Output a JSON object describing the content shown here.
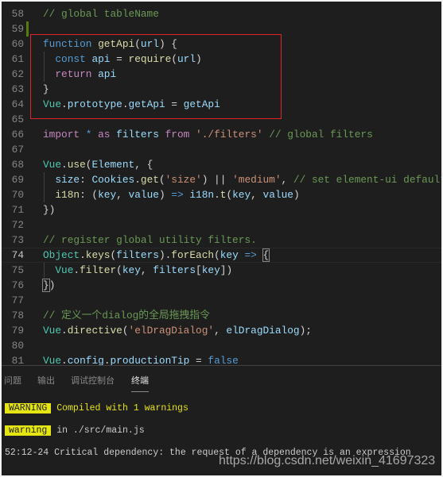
{
  "editor": {
    "current_line": 74,
    "lines": [
      {
        "n": "58",
        "t": [
          [
            "// global tableName",
            "cmt"
          ]
        ]
      },
      {
        "n": "59",
        "t": []
      },
      {
        "n": "60",
        "t": [
          [
            "function",
            "kw"
          ],
          [
            " ",
            "op"
          ],
          [
            "getApi",
            "fn"
          ],
          [
            "(",
            "op"
          ],
          [
            "url",
            "var"
          ],
          [
            ") {",
            "op"
          ]
        ]
      },
      {
        "n": "61",
        "t": [
          [
            "  ",
            "op"
          ],
          [
            "const",
            "kw"
          ],
          [
            " ",
            "op"
          ],
          [
            "api",
            "var"
          ],
          [
            " = ",
            "op"
          ],
          [
            "require",
            "fn"
          ],
          [
            "(",
            "op"
          ],
          [
            "url",
            "var"
          ],
          [
            ")",
            "op"
          ]
        ]
      },
      {
        "n": "62",
        "t": [
          [
            "  ",
            "op"
          ],
          [
            "return",
            "ctl"
          ],
          [
            " ",
            "op"
          ],
          [
            "api",
            "var"
          ]
        ]
      },
      {
        "n": "63",
        "t": [
          [
            "}",
            "op"
          ]
        ]
      },
      {
        "n": "64",
        "t": [
          [
            "Vue",
            "cls"
          ],
          [
            ".",
            "op"
          ],
          [
            "prototype",
            "var"
          ],
          [
            ".",
            "op"
          ],
          [
            "getApi",
            "var"
          ],
          [
            " = ",
            "op"
          ],
          [
            "getApi",
            "var"
          ]
        ]
      },
      {
        "n": "65",
        "t": []
      },
      {
        "n": "66",
        "t": [
          [
            "import",
            "ctl"
          ],
          [
            " * ",
            "kw"
          ],
          [
            "as",
            "ctl"
          ],
          [
            " ",
            "op"
          ],
          [
            "filters",
            "var"
          ],
          [
            " ",
            "op"
          ],
          [
            "from",
            "ctl"
          ],
          [
            " ",
            "op"
          ],
          [
            "'./filters'",
            "str"
          ],
          [
            " ",
            "op"
          ],
          [
            "// global filters",
            "cmt"
          ]
        ]
      },
      {
        "n": "67",
        "t": []
      },
      {
        "n": "68",
        "t": [
          [
            "Vue",
            "cls"
          ],
          [
            ".",
            "op"
          ],
          [
            "use",
            "fn"
          ],
          [
            "(",
            "op"
          ],
          [
            "Element",
            "var"
          ],
          [
            ", {",
            "op"
          ]
        ]
      },
      {
        "n": "69",
        "t": [
          [
            "  ",
            "op"
          ],
          [
            "size",
            "var"
          ],
          [
            ": ",
            "op"
          ],
          [
            "Cookies",
            "var"
          ],
          [
            ".",
            "op"
          ],
          [
            "get",
            "fn"
          ],
          [
            "(",
            "op"
          ],
          [
            "'size'",
            "str"
          ],
          [
            ") || ",
            "op"
          ],
          [
            "'medium'",
            "str"
          ],
          [
            ", ",
            "op"
          ],
          [
            "// set element-ui default size",
            "cmt"
          ]
        ]
      },
      {
        "n": "70",
        "t": [
          [
            "  ",
            "op"
          ],
          [
            "i18n",
            "fn"
          ],
          [
            ": (",
            "op"
          ],
          [
            "key",
            "var"
          ],
          [
            ", ",
            "op"
          ],
          [
            "value",
            "var"
          ],
          [
            ") ",
            "op"
          ],
          [
            "=>",
            "kw"
          ],
          [
            " ",
            "op"
          ],
          [
            "i18n",
            "var"
          ],
          [
            ".",
            "op"
          ],
          [
            "t",
            "fn"
          ],
          [
            "(",
            "op"
          ],
          [
            "key",
            "var"
          ],
          [
            ", ",
            "op"
          ],
          [
            "value",
            "var"
          ],
          [
            ")",
            "op"
          ]
        ]
      },
      {
        "n": "71",
        "t": [
          [
            "})",
            "op"
          ]
        ]
      },
      {
        "n": "72",
        "t": []
      },
      {
        "n": "73",
        "t": [
          [
            "// register global utility filters.",
            "cmt"
          ]
        ]
      },
      {
        "n": "74",
        "t": [
          [
            "Object",
            "cls"
          ],
          [
            ".",
            "op"
          ],
          [
            "keys",
            "fn"
          ],
          [
            "(",
            "op"
          ],
          [
            "filters",
            "var"
          ],
          [
            ").",
            "op"
          ],
          [
            "forEach",
            "fn"
          ],
          [
            "(",
            "op"
          ],
          [
            "key",
            "var"
          ],
          [
            " ",
            "op"
          ],
          [
            "=>",
            "kw"
          ],
          [
            " ",
            "op"
          ],
          [
            "{",
            "bm"
          ]
        ]
      },
      {
        "n": "75",
        "t": [
          [
            "  ",
            "op"
          ],
          [
            "Vue",
            "cls"
          ],
          [
            ".",
            "op"
          ],
          [
            "filter",
            "fn"
          ],
          [
            "(",
            "op"
          ],
          [
            "key",
            "var"
          ],
          [
            ", ",
            "op"
          ],
          [
            "filters",
            "var"
          ],
          [
            "[",
            "op"
          ],
          [
            "key",
            "var"
          ],
          [
            "])",
            "op"
          ]
        ]
      },
      {
        "n": "76",
        "t": [
          [
            "}",
            "bm"
          ],
          [
            ")",
            "op"
          ]
        ]
      },
      {
        "n": "77",
        "t": []
      },
      {
        "n": "78",
        "t": [
          [
            "// 定义一个dialog的全局拖拽指令",
            "cmt"
          ]
        ]
      },
      {
        "n": "79",
        "t": [
          [
            "Vue",
            "cls"
          ],
          [
            ".",
            "op"
          ],
          [
            "directive",
            "fn"
          ],
          [
            "(",
            "op"
          ],
          [
            "'elDragDialog'",
            "str"
          ],
          [
            ", ",
            "op"
          ],
          [
            "elDragDialog",
            "var"
          ],
          [
            ");",
            "op"
          ]
        ]
      },
      {
        "n": "80",
        "t": []
      },
      {
        "n": "81",
        "t": [
          [
            "Vue",
            "cls"
          ],
          [
            ".",
            "op"
          ],
          [
            "config",
            "var"
          ],
          [
            ".",
            "op"
          ],
          [
            "productionTip",
            "var"
          ],
          [
            " = ",
            "op"
          ],
          [
            "false",
            "kw"
          ]
        ]
      }
    ]
  },
  "panel": {
    "tabs": [
      {
        "label": "问题",
        "active": false
      },
      {
        "label": "输出",
        "active": false
      },
      {
        "label": "调试控制台",
        "active": false
      },
      {
        "label": "终端",
        "active": true
      }
    ],
    "terminal": {
      "line1_badge": "WARNING",
      "line1_text": "Compiled with 1 warnings",
      "line2_badge": "warning",
      "line2_text": "in ./src/main.js",
      "line3_text": "52:12-24 Critical dependency: the request of a dependency is an expression"
    }
  },
  "watermark": "https://blog.csdn.net/weixin_41697323",
  "colors": {
    "background": "#1e1e1e",
    "highlight_box": "#e0242a",
    "warning_badge": "#e5e510"
  }
}
